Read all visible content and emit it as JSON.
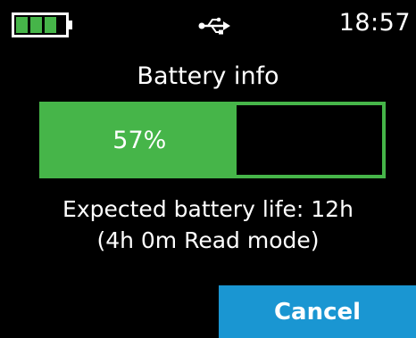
{
  "status_bar": {
    "battery_icon": "battery-icon",
    "connection_icon": "usb-icon",
    "time": "18:57"
  },
  "screen": {
    "title": "Battery info",
    "battery_level_percent": 57,
    "battery_level_label": "57%",
    "expected_life_text": "Expected battery life: 12h",
    "read_mode_text": "(4h 0m Read mode)"
  },
  "actions": {
    "cancel_label": "Cancel"
  },
  "colors": {
    "background": "#000000",
    "battery_green": "#46b549",
    "button_blue": "#1a96d2",
    "text": "#ffffff"
  }
}
